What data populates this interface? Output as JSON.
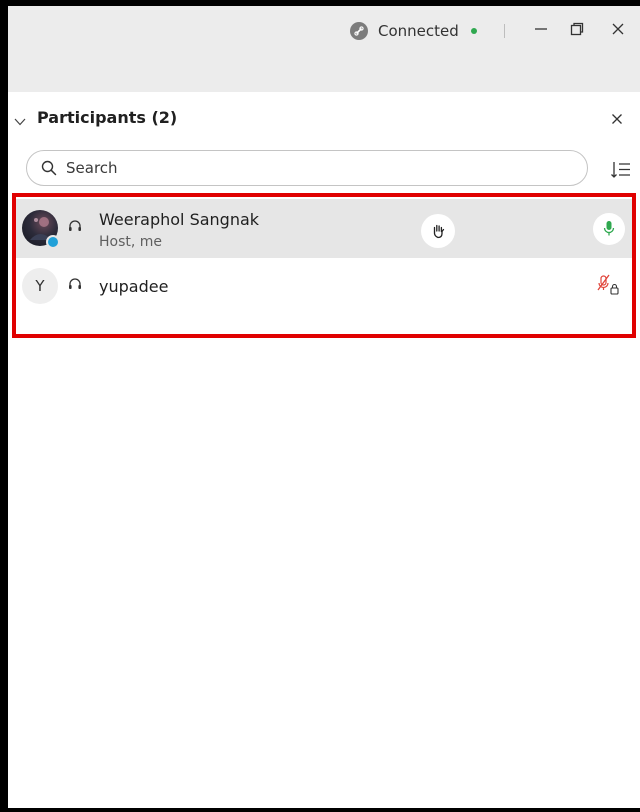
{
  "titlebar": {
    "status_text": "Connected",
    "status_color": "#2fa84f",
    "icons": [
      "link-status-icon",
      "minimize-icon",
      "restore-icon",
      "close-icon"
    ]
  },
  "panel": {
    "title": "Participants (2)",
    "close_icon": "close-icon",
    "collapse_icon": "chevron-down-icon"
  },
  "search": {
    "placeholder": "Search",
    "value": ""
  },
  "sort_icon": "sort-list-icon",
  "participants": [
    {
      "name": "Weeraphol Sangnak",
      "role": "Host, me",
      "audio": "headset-icon",
      "hand_icon": "raise-hand-icon",
      "mic_state": "unmuted",
      "mic_color": "#2fa84f"
    },
    {
      "name": "yupadee",
      "initial": "Y",
      "audio": "headset-icon",
      "mic_state": "muted-locked",
      "mic_color": "#e0443a"
    }
  ],
  "highlight_color": "#e00000"
}
